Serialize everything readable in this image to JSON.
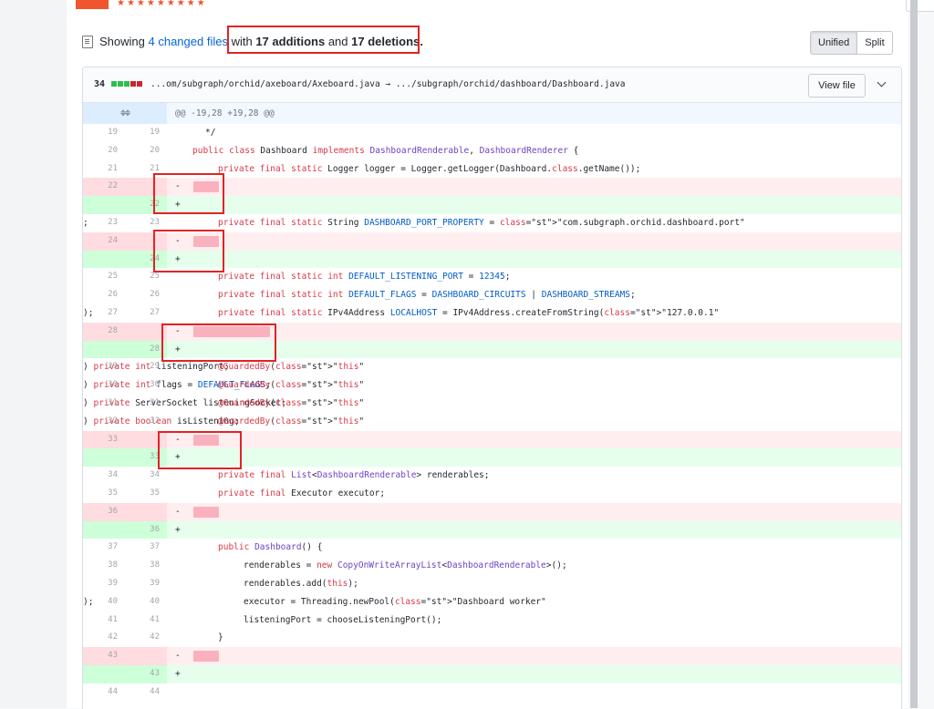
{
  "summary": {
    "prefix": "Showing",
    "changed_files": "4 changed files",
    "with": "with",
    "additions": "17 additions",
    "and": "and",
    "deletions": "17 deletions."
  },
  "view_toggle": {
    "unified": "Unified",
    "split": "Split"
  },
  "file": {
    "diffstat": "34",
    "bar_colors": [
      "#2cbe4e",
      "#2cbe4e",
      "#2cbe4e",
      "#cb2431",
      "#cb2431"
    ],
    "path": "...om/subgraph/orchid/axeboard/Axeboard.java → .../subgraph/orchid/dashboard/Dashboard.java",
    "view_file": "View file"
  },
  "hunk": {
    "expand": "≑≑",
    "header": "@@ -19,28 +19,28 @@"
  },
  "lines": [
    {
      "t": "ctx",
      "o": "19",
      "n": "19",
      "indent": 1,
      "c": "*/"
    },
    {
      "t": "ctx",
      "o": "20",
      "n": "20",
      "indent": 0,
      "c": "public class Dashboard implements DashboardRenderable, DashboardRenderer {"
    },
    {
      "t": "ctx",
      "o": "21",
      "n": "21",
      "indent": 2,
      "c": "private final static Logger logger = Logger.getLogger(Dashboard.class.getName());"
    },
    {
      "t": "del",
      "o": "22",
      "n": "",
      "blob": 28
    },
    {
      "t": "add",
      "o": "",
      "n": "22"
    },
    {
      "t": "ctx",
      "o": "23",
      "n": "23",
      "indent": 2,
      "c": "private final static String DASHBOARD_PORT_PROPERTY = \"com.subgraph.orchid.dashboard.port\";"
    },
    {
      "t": "del",
      "o": "24",
      "n": "",
      "blob": 28
    },
    {
      "t": "add",
      "o": "",
      "n": "24"
    },
    {
      "t": "ctx",
      "o": "25",
      "n": "25",
      "indent": 2,
      "c": "private final static int DEFAULT_LISTENING_PORT = 12345;"
    },
    {
      "t": "ctx",
      "o": "26",
      "n": "26",
      "indent": 2,
      "c": "private final static int DEFAULT_FLAGS = DASHBOARD_CIRCUITS | DASHBOARD_STREAMS;"
    },
    {
      "t": "ctx",
      "o": "27",
      "n": "27",
      "indent": 2,
      "c": "private final static IPv4Address LOCALHOST = IPv4Address.createFromString(\"127.0.0.1\");"
    },
    {
      "t": "del",
      "o": "28",
      "n": "",
      "blob": 84
    },
    {
      "t": "add",
      "o": "",
      "n": "28"
    },
    {
      "t": "ctx",
      "o": "29",
      "n": "29",
      "indent": 2,
      "c": "@GuardedBy(\"this\") private int listeningPort;"
    },
    {
      "t": "ctx",
      "o": "30",
      "n": "30",
      "indent": 2,
      "c": "@GuardedBy(\"this\") private int flags = DEFAULT_FLAGS;"
    },
    {
      "t": "ctx",
      "o": "31",
      "n": "31",
      "indent": 2,
      "c": "@GuardedBy(\"this\") private ServerSocket listeningSocket;"
    },
    {
      "t": "ctx",
      "o": "32",
      "n": "32",
      "indent": 2,
      "c": "@GuardedBy(\"this\") private boolean isListening;"
    },
    {
      "t": "del",
      "o": "33",
      "n": "",
      "blob": 28
    },
    {
      "t": "add",
      "o": "",
      "n": "33"
    },
    {
      "t": "ctx",
      "o": "34",
      "n": "34",
      "indent": 2,
      "c": "private final List<DashboardRenderable> renderables;"
    },
    {
      "t": "ctx",
      "o": "35",
      "n": "35",
      "indent": 2,
      "c": "private final Executor executor;"
    },
    {
      "t": "del",
      "o": "36",
      "n": "",
      "blob": 28
    },
    {
      "t": "add",
      "o": "",
      "n": "36"
    },
    {
      "t": "ctx",
      "o": "37",
      "n": "37",
      "indent": 2,
      "c": "public Dashboard() {"
    },
    {
      "t": "ctx",
      "o": "38",
      "n": "38",
      "indent": 4,
      "c": "renderables = new CopyOnWriteArrayList<DashboardRenderable>();"
    },
    {
      "t": "ctx",
      "o": "39",
      "n": "39",
      "indent": 4,
      "c": "renderables.add(this);"
    },
    {
      "t": "ctx",
      "o": "40",
      "n": "40",
      "indent": 4,
      "c": "executor = Threading.newPool(\"Dashboard worker\");"
    },
    {
      "t": "ctx",
      "o": "41",
      "n": "41",
      "indent": 4,
      "c": "listeningPort = chooseListeningPort();"
    },
    {
      "t": "ctx",
      "o": "42",
      "n": "42",
      "indent": 2,
      "c": "}"
    },
    {
      "t": "del",
      "o": "43",
      "n": "",
      "blob": 28
    },
    {
      "t": "add",
      "o": "",
      "n": "43"
    },
    {
      "t": "ctx",
      "o": "44",
      "n": "44",
      "indent": 0,
      "c": ""
    }
  ],
  "signs": {
    "del": "-",
    "add": "+"
  },
  "annotations": {
    "highlight_color": "#e02424"
  }
}
